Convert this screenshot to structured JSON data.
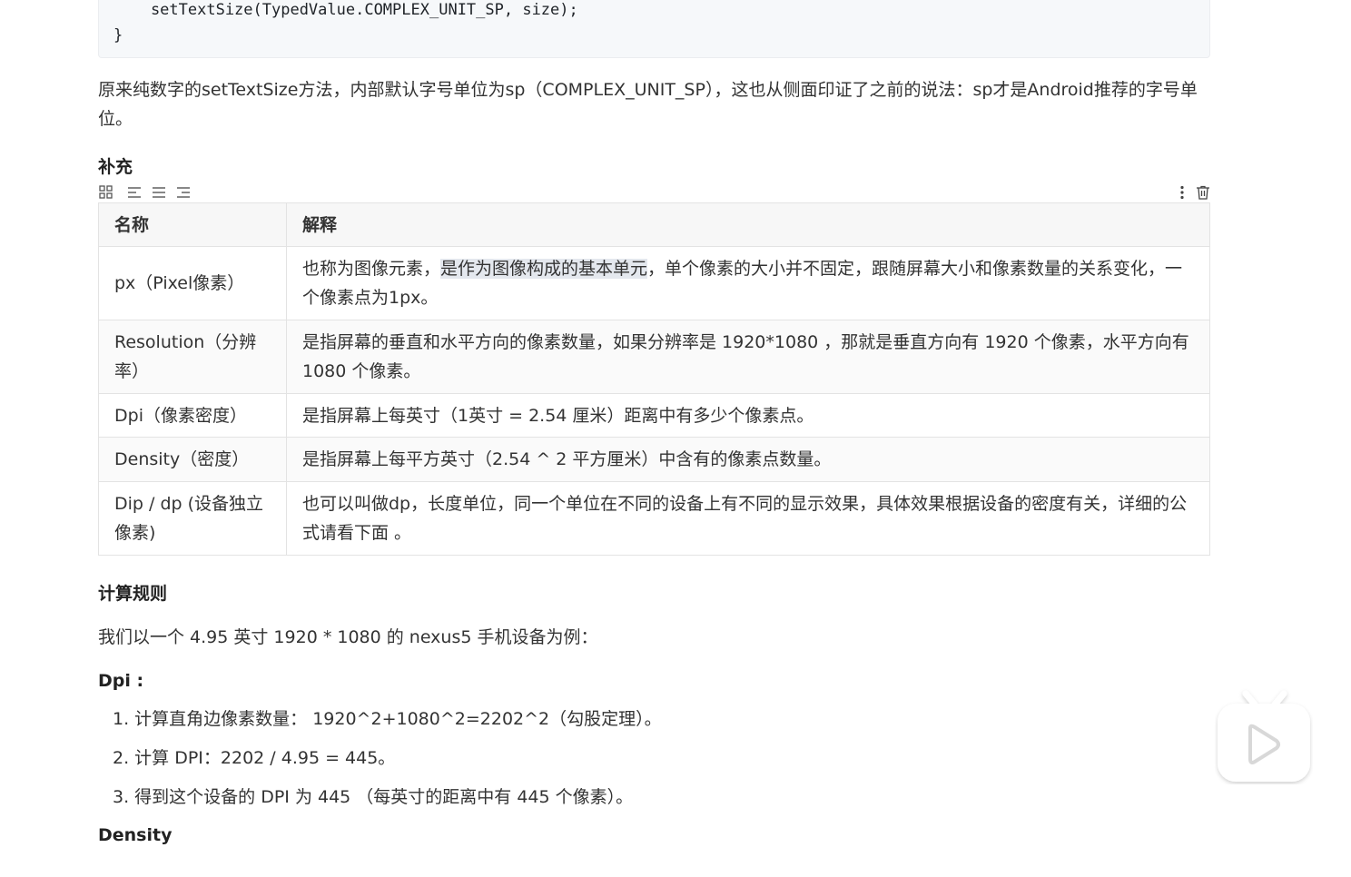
{
  "code": {
    "line1": "    setTextSize(TypedValue.COMPLEX_UNIT_SP, size);",
    "line2": "}"
  },
  "intro_paragraph": "原来纯数字的setTextSize方法，内部默认字号单位为sp（COMPLEX_UNIT_SP），这也从侧面印证了之前的说法：sp才是Android推荐的字号单位。",
  "supplement_heading": "补充",
  "table": {
    "headers": [
      "名称",
      "解释"
    ],
    "rows": [
      {
        "name": "px（Pixel像素）",
        "desc_pre": "也称为图像元素，",
        "desc_hl": "是作为图像构成的基本单元",
        "desc_post": "，单个像素的大小并不固定，跟随屏幕大小和像素数量的关系变化，一个像素点为1px。"
      },
      {
        "name": "Resolution（分辨率）",
        "desc": "是指屏幕的垂直和水平方向的像素数量，如果分辨率是 1920*1080 ，那就是垂直方向有 1920 个像素，水平方向有 1080 个像素。"
      },
      {
        "name": "Dpi（像素密度）",
        "desc": "是指屏幕上每英寸（1英寸 = 2.54 厘米）距离中有多少个像素点。"
      },
      {
        "name": "Density（密度）",
        "desc": "是指屏幕上每平方英寸（2.54 ^ 2 平方厘米）中含有的像素点数量。"
      },
      {
        "name": "Dip / dp (设备独立像素)",
        "desc": "也可以叫做dp，长度单位，同一个单位在不同的设备上有不同的显示效果，具体效果根据设备的密度有关，详细的公式请看下面 。"
      }
    ]
  },
  "calc_heading": "计算规则",
  "calc_intro": "我们以一个 4.95 英寸 1920 * 1080 的 nexus5 手机设备为例：",
  "dpi_heading": "Dpi :",
  "dpi_steps": [
    "1. 计算直角边像素数量： 1920^2+1080^2=2202^2（勾股定理）。",
    "2. 计算 DPI：2202 / 4.95 = 445。",
    "3. 得到这个设备的 DPI 为 445 （每英寸的距离中有 445 个像素）。"
  ],
  "density_heading": "Density",
  "icons": {
    "grid": "grid-icon",
    "align_left": "align-left-icon",
    "align_center": "align-center-icon",
    "align_right": "align-right-icon",
    "more": "more-vertical-icon",
    "delete": "trash-icon",
    "play": "play-icon"
  },
  "colors": {
    "highlight": "#e4e8ee",
    "code_bg": "#f6f8fa",
    "border": "#e3e3e3"
  }
}
